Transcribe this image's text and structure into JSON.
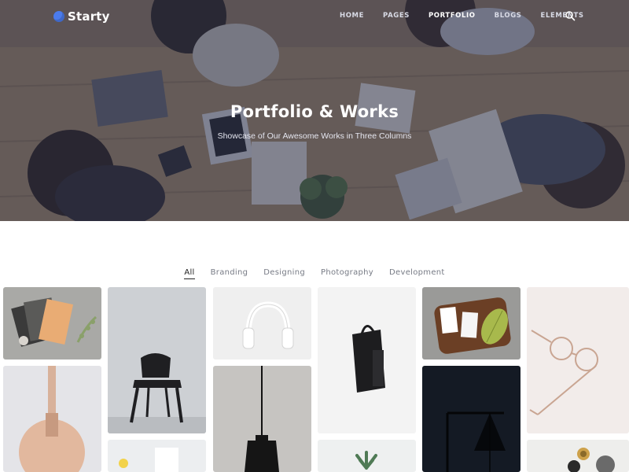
{
  "brand": {
    "name": "Starty",
    "accent": "#4b7bec"
  },
  "nav": {
    "items": [
      {
        "label": "HOME",
        "active": false
      },
      {
        "label": "PAGES",
        "active": false
      },
      {
        "label": "PORTFOLIO",
        "active": true
      },
      {
        "label": "BLOGS",
        "active": false
      },
      {
        "label": "ELEMENTS",
        "active": false
      }
    ],
    "search_icon": "search-icon"
  },
  "hero": {
    "title": "Portfolio & Works",
    "subtitle": "Showcase of Our Awesome Works in Three Columns"
  },
  "filters": {
    "items": [
      {
        "label": "All",
        "active": true
      },
      {
        "label": "Branding",
        "active": false
      },
      {
        "label": "Designing",
        "active": false
      },
      {
        "label": "Photography",
        "active": false
      },
      {
        "label": "Development",
        "active": false
      }
    ]
  }
}
